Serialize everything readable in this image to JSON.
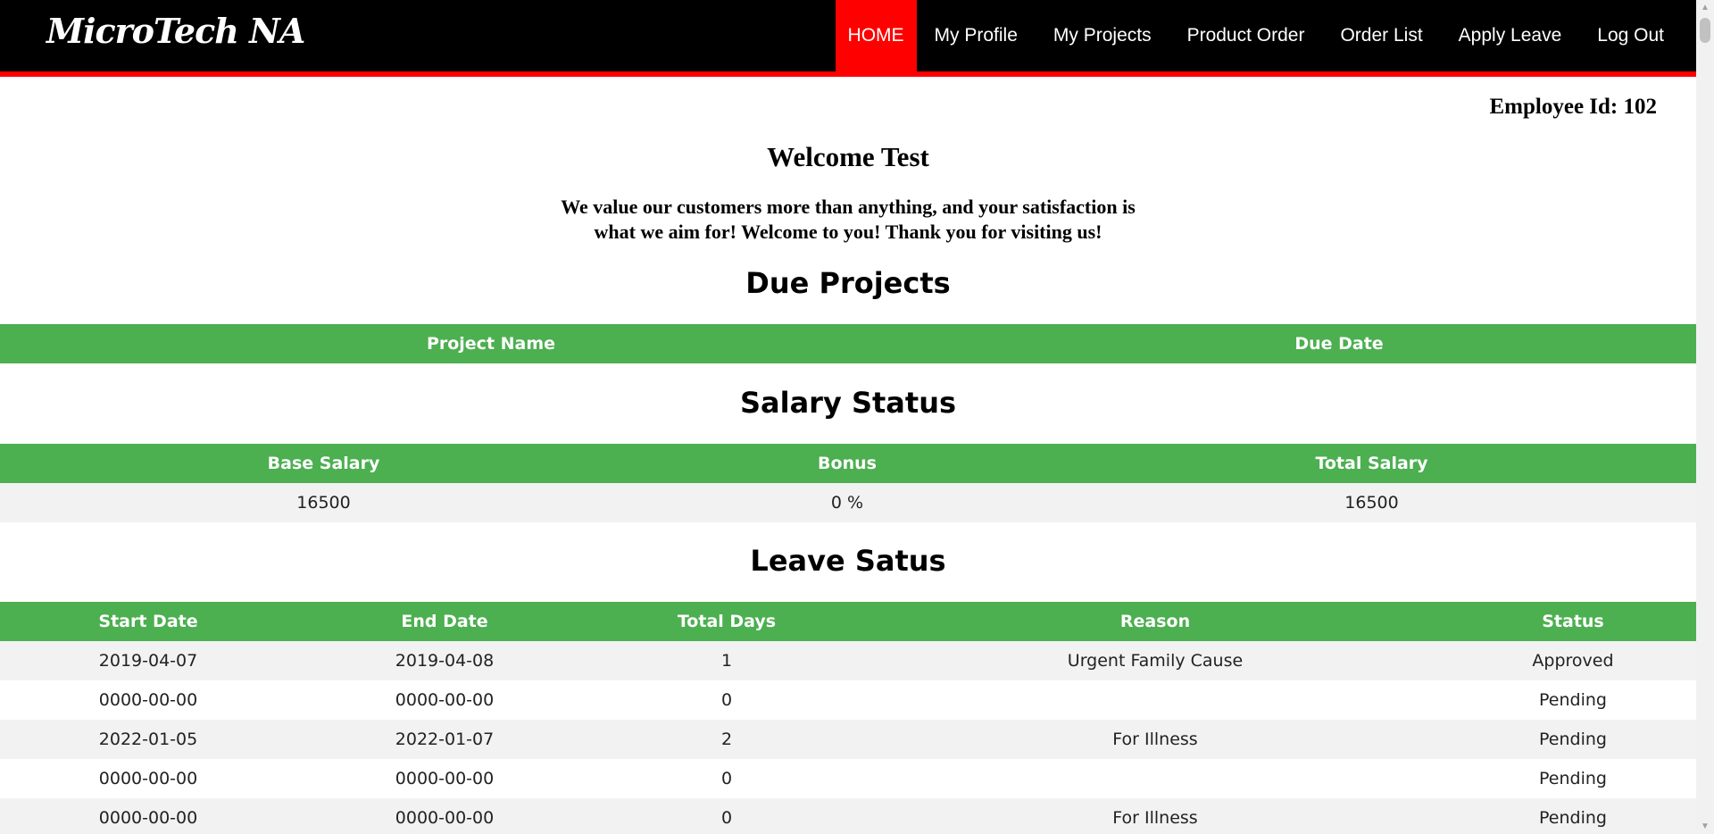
{
  "brand": "MicroTech NA",
  "nav": {
    "home": "HOME",
    "profile": "My Profile",
    "projects": "My Projects",
    "product_order": "Product Order",
    "order_list": "Order List",
    "apply_leave": "Apply Leave",
    "logout": "Log Out"
  },
  "employee_id": "Employee Id: 102",
  "welcome": "Welcome Test",
  "message_line1": "We value our customers more than anything, and your satisfaction is",
  "message_line2": "what we aim for! Welcome to you! Thank you for visiting us!",
  "due_projects": {
    "title": "Due Projects",
    "headers": [
      "Project Name",
      "Due Date"
    ]
  },
  "salary": {
    "title": "Salary Status",
    "headers": [
      "Base Salary",
      "Bonus",
      "Total Salary"
    ],
    "row": [
      "16500",
      "0 %",
      "16500"
    ]
  },
  "leave": {
    "title": "Leave Satus",
    "headers": [
      "Start Date",
      "End Date",
      "Total Days",
      "Reason",
      "Status"
    ],
    "rows": [
      [
        "2019-04-07",
        "2019-04-08",
        "1",
        "Urgent Family Cause",
        "Approved"
      ],
      [
        "0000-00-00",
        "0000-00-00",
        "0",
        "",
        "Pending"
      ],
      [
        "2022-01-05",
        "2022-01-07",
        "2",
        "For Illness",
        "Pending"
      ],
      [
        "0000-00-00",
        "0000-00-00",
        "0",
        "",
        "Pending"
      ],
      [
        "0000-00-00",
        "0000-00-00",
        "0",
        "For Illness",
        "Pending"
      ]
    ]
  },
  "colors": {
    "header_bg": "#000000",
    "accent_red": "#ff0000",
    "table_green": "#4caf50",
    "row_stripe": "#f2f2f2"
  },
  "icons": {
    "scroll_up": "triangle-up",
    "scroll_down": "triangle-down"
  }
}
